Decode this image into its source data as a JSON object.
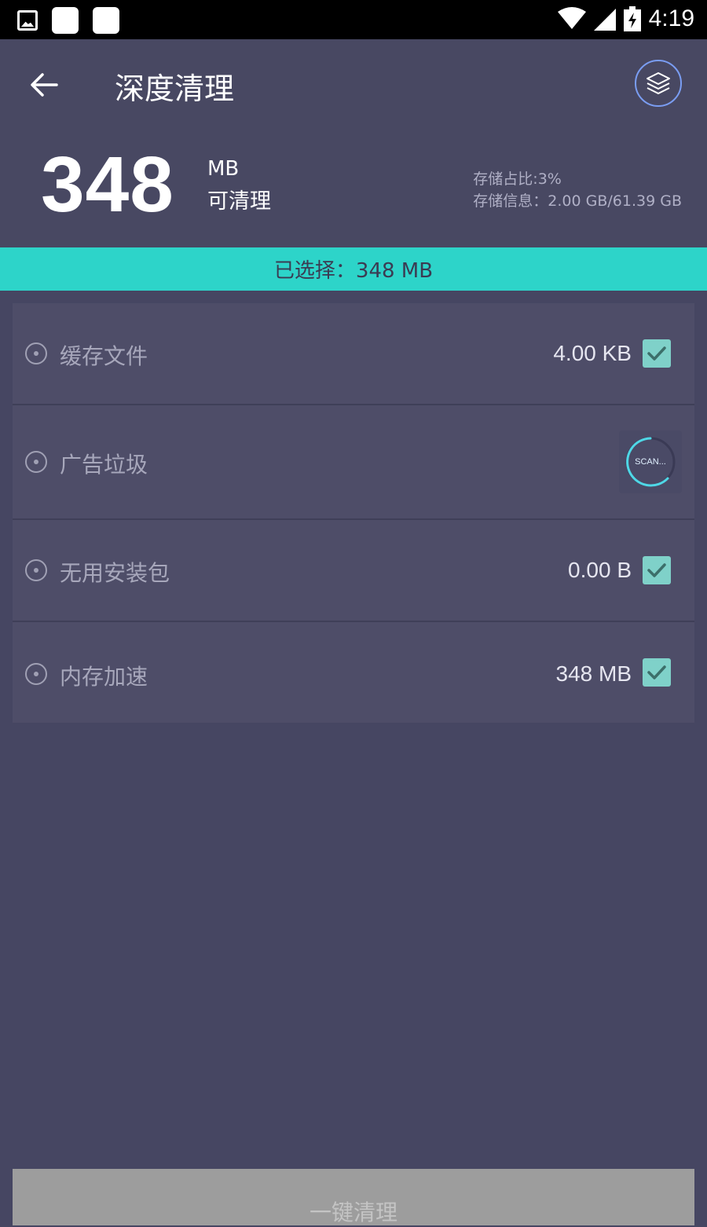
{
  "status_bar": {
    "time": "4:19"
  },
  "header": {
    "title": "深度清理",
    "amount": "348",
    "unit": "MB",
    "cleanable_label": "可清理",
    "storage_ratio": "存储占比:3%",
    "storage_info": "存储信息：2.00 GB/61.39 GB"
  },
  "selected_bar": {
    "text": "已选择：348 MB"
  },
  "items": [
    {
      "label": "缓存文件",
      "size": "4.00 KB",
      "checked": true
    },
    {
      "label": "广告垃圾",
      "status": "SCAN..."
    },
    {
      "label": "无用安装包",
      "size": "0.00 B",
      "checked": true
    },
    {
      "label": "内存加速",
      "size": "348 MB",
      "checked": true
    }
  ],
  "action_button": {
    "label": "一键清理"
  },
  "colors": {
    "background": "#464662",
    "accent_bar": "#2dd4c9",
    "checkbox": "#7fd1c9",
    "button_disabled": "#9d9d9d"
  },
  "icons": [
    "image-icon",
    "wifi-icon",
    "signal-icon",
    "battery-charging-icon",
    "back-arrow-icon",
    "layers-icon",
    "radio-dot-icon",
    "checkbox-checked-icon",
    "scan-spinner-icon"
  ]
}
